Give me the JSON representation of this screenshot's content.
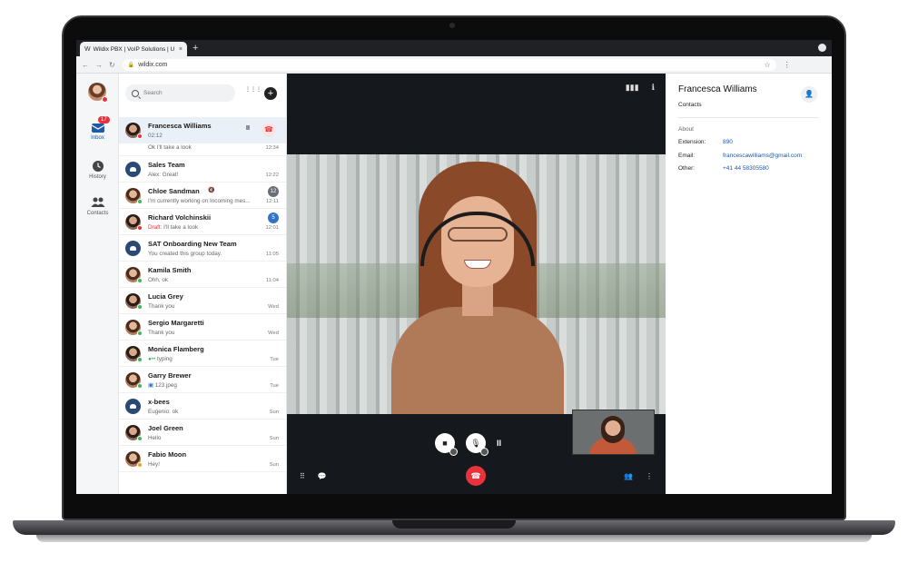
{
  "browser": {
    "tab_title": "Wildix PBX | VoIP Solutions | U",
    "tab_close": "×",
    "new_tab": "+",
    "url": "wildix.com"
  },
  "rail": {
    "items": [
      {
        "label": "Inbox",
        "badge": "17"
      },
      {
        "label": "History"
      },
      {
        "label": "Contacts"
      }
    ]
  },
  "list": {
    "search_placeholder": "Search",
    "conversations": [
      {
        "name": "Francesca Williams",
        "preview": "02:12",
        "time": "",
        "status": "red",
        "active": true
      },
      {
        "name": "",
        "preview": "Ok I'll take a look",
        "time": "12:34",
        "status": "green"
      },
      {
        "name": "Sales Team",
        "preview": "Alex: Great!",
        "time": "12:22",
        "group": true
      },
      {
        "name": "Chloe Sandman",
        "preview": "I'm currently working on Incoming mes...",
        "time": "12:11",
        "count": "12",
        "status": "green"
      },
      {
        "name": "Richard Volchinskii",
        "draft": "Draft:",
        "preview": "I'll take a look",
        "time": "12:01",
        "count": "5",
        "status": "red"
      },
      {
        "name": "SAT Onboarding New Team",
        "preview": "You created this group today.",
        "time": "11:05",
        "group": true
      },
      {
        "name": "Kamila Smith",
        "preview": "Ohh, ok",
        "time": "11:04",
        "status": "green"
      },
      {
        "name": "Lucia Grey",
        "preview": "Thank you",
        "time": "Wed",
        "status": "green"
      },
      {
        "name": "Sergio Margaretti",
        "preview": "Thank you",
        "time": "Wed",
        "status": "green"
      },
      {
        "name": "Monica Flamberg",
        "preview": "typing",
        "time": "Tue",
        "status": "green"
      },
      {
        "name": "Garry Brewer",
        "preview": "123.jpeg",
        "time": "Tue",
        "status": "green"
      },
      {
        "name": "x-bees",
        "preview": "Eugenio: ok",
        "time": "Sun",
        "group": true
      },
      {
        "name": "Joel Green",
        "preview": "Hello",
        "time": "Sun",
        "status": "green"
      },
      {
        "name": "Fabio Moon",
        "preview": "Hey!",
        "time": "Sun",
        "status": "orange"
      }
    ]
  },
  "details": {
    "name": "Francesca Williams",
    "subtitle": "Contacts",
    "section": "About",
    "fields": [
      {
        "label": "Extension:",
        "value": "890"
      },
      {
        "label": "Email:",
        "value": "francescawilliams@gmail.com"
      },
      {
        "label": "Other:",
        "value": "+41 44 58305580"
      }
    ]
  },
  "colors": {
    "accent": "#1e58a8",
    "danger": "#e8323c",
    "online": "#3dbb5a",
    "video_bg": "#15191e"
  }
}
